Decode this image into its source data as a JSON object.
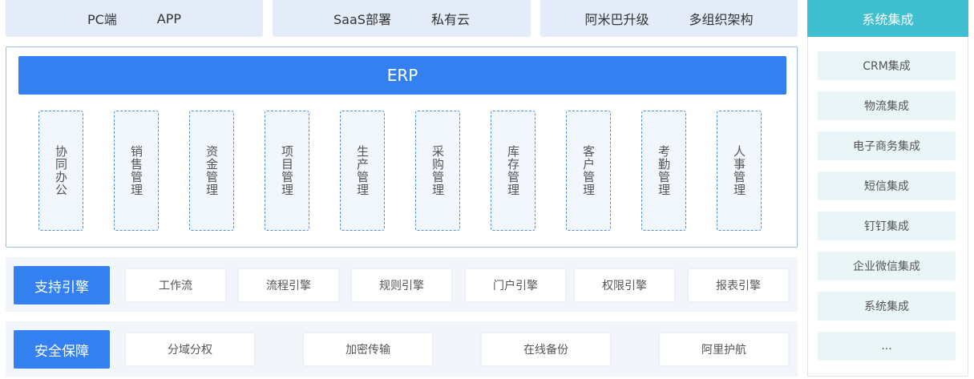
{
  "top_row": [
    {
      "left": "PC端",
      "right": "APP"
    },
    {
      "left": "SaaS部署",
      "right": "私有云"
    },
    {
      "left": "阿米巴升级",
      "right": "多组织架构"
    }
  ],
  "erp": {
    "title": "ERP",
    "modules": [
      "协同办公",
      "销售管理",
      "资金管理",
      "项目管理",
      "生产管理",
      "采购管理",
      "库存管理",
      "客户管理",
      "考勤管理",
      "人事管理"
    ]
  },
  "support_engine": {
    "title": "支持引擎",
    "items": [
      "工作流",
      "流程引擎",
      "规则引擎",
      "门户引擎",
      "权限引擎",
      "报表引擎"
    ]
  },
  "security": {
    "title": "安全保障",
    "items": [
      "分域分权",
      "加密传输",
      "在线备份",
      "阿里护航"
    ]
  },
  "integration": {
    "title": "系统集成",
    "items": [
      "CRM集成",
      "物流集成",
      "电子商务集成",
      "短信集成",
      "钉钉集成",
      "企业微信集成",
      "系统集成",
      "..."
    ]
  },
  "colors": {
    "primary_blue": "#3580f0",
    "light_blue_bg": "#e4ecf9",
    "teal": "#40bfd0",
    "teal_light": "#e9f5f7"
  }
}
